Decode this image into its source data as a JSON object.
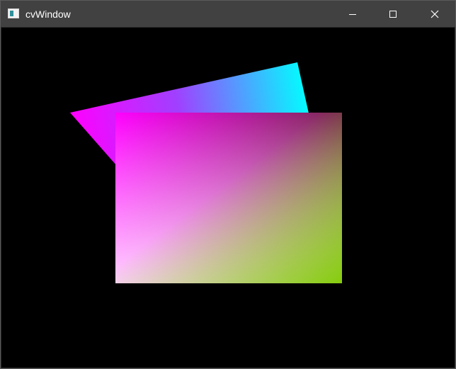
{
  "window": {
    "title": "cvWindow",
    "icon": "app-window-icon",
    "controls": [
      {
        "name": "minimize-button",
        "icon": "minimize-icon"
      },
      {
        "name": "maximize-button",
        "icon": "maximize-icon"
      },
      {
        "name": "close-button",
        "icon": "close-icon"
      }
    ]
  },
  "canvas": {
    "background": "#000000",
    "shapes": [
      {
        "kind": "rotated-quad",
        "gradient_colors": [
          "#ff00ff",
          "#00ffff"
        ]
      },
      {
        "kind": "rectangle",
        "corner_colors": {
          "top-left": "#ff00ff",
          "top-right": "#800060",
          "bottom-left": "#ffd8ff",
          "bottom-right": "#80cc00"
        }
      }
    ]
  }
}
